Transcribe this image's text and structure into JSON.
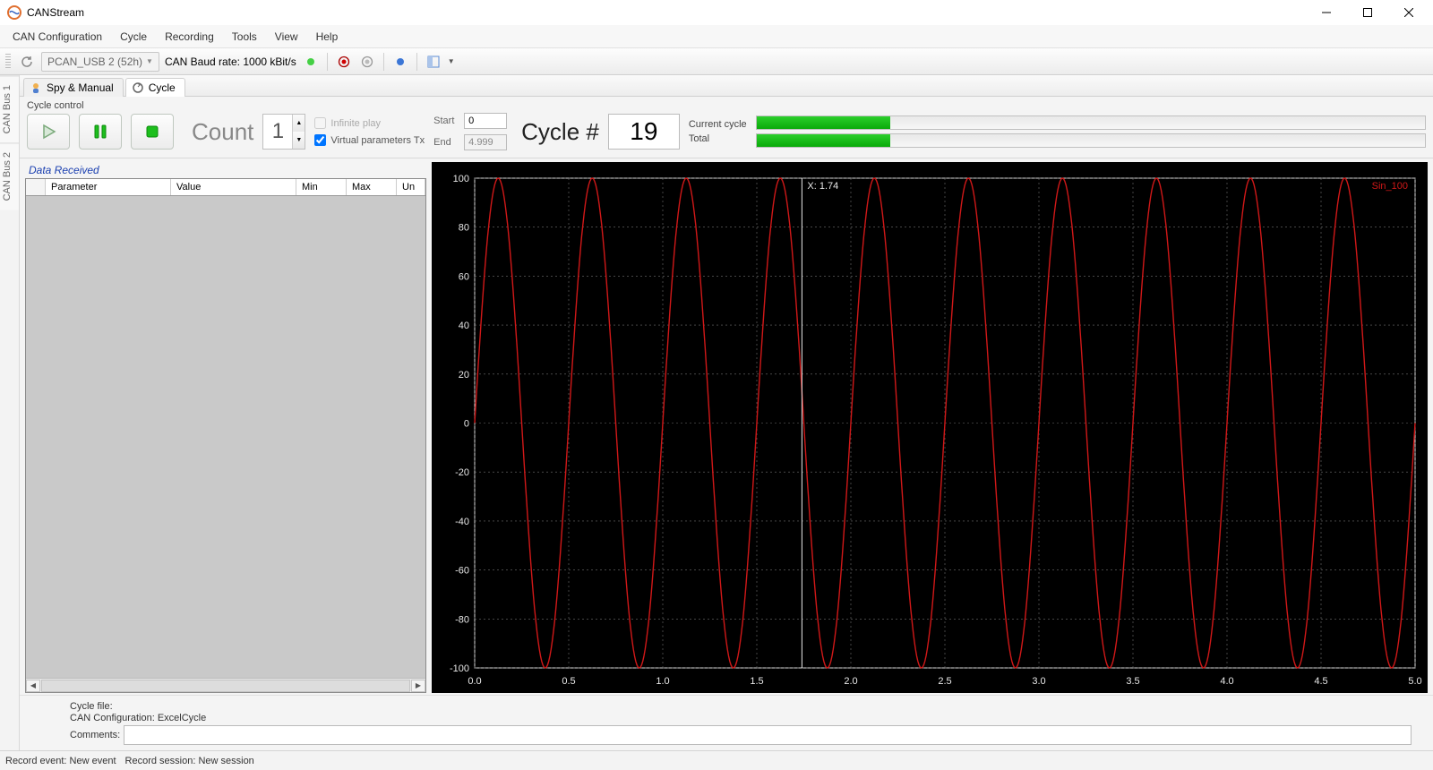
{
  "window": {
    "title": "CANStream"
  },
  "menu": {
    "can_config": "CAN Configuration",
    "cycle": "Cycle",
    "recording": "Recording",
    "tools": "Tools",
    "view": "View",
    "help": "Help"
  },
  "toolbar": {
    "device": "PCAN_USB 2 (52h)",
    "baud": "CAN Baud rate: 1000 kBit/s"
  },
  "vtabs": {
    "bus1": "CAN Bus 1",
    "bus2": "CAN Bus 2"
  },
  "doctabs": {
    "spy": "Spy & Manual",
    "cycle": "Cycle"
  },
  "cycle": {
    "group": "Cycle control",
    "count_label": "Count",
    "count_value": "1",
    "infinite": "Infinite play",
    "virtual": "Virtual parameters Tx",
    "start_label": "Start",
    "start_value": "0",
    "end_label": "End",
    "end_value": "4.999",
    "hash_label": "Cycle #",
    "hash_value": "19",
    "current_label": "Current cycle",
    "total_label": "Total",
    "progress_pct": "20%"
  },
  "grid": {
    "title": "Data Received",
    "cols": {
      "param": "Parameter",
      "value": "Value",
      "min": "Min",
      "max": "Max",
      "un": "Un"
    }
  },
  "graph": {
    "cursor_label": "X: 1.74",
    "series_label": "Sin_100",
    "y_ticks": [
      "100",
      "80",
      "60",
      "40",
      "20",
      "0",
      "-20",
      "-40",
      "-60",
      "-80",
      "-100"
    ],
    "x_ticks": [
      "0.0",
      "0.5",
      "1.0",
      "1.5",
      "2.0",
      "2.5",
      "3.0",
      "3.5",
      "4.0",
      "4.5",
      "5.0"
    ]
  },
  "info": {
    "cycle_file": "Cycle file:",
    "can_config": "CAN Configuration: ExcelCycle",
    "comments": "Comments:"
  },
  "status": {
    "record_event": "Record event: New event",
    "record_session": "Record session: New session"
  },
  "chart_data": {
    "type": "line",
    "title": "",
    "xlabel": "",
    "ylabel": "",
    "xlim": [
      0.0,
      5.0
    ],
    "ylim": [
      -100,
      100
    ],
    "cursor_x": 1.74,
    "series": [
      {
        "name": "Sin_100",
        "color": "#d01818",
        "function": "100 * sin(2*pi*2*x)",
        "frequency_hz": 2.0,
        "amplitude": 100,
        "sample_points_approx": [
          {
            "x": 0.0,
            "y": 0
          },
          {
            "x": 0.125,
            "y": 100
          },
          {
            "x": 0.25,
            "y": 0
          },
          {
            "x": 0.375,
            "y": -100
          },
          {
            "x": 0.5,
            "y": 0
          },
          {
            "x": 0.625,
            "y": 100
          },
          {
            "x": 0.75,
            "y": 0
          },
          {
            "x": 0.875,
            "y": -100
          },
          {
            "x": 1.0,
            "y": 0
          },
          {
            "x": 1.125,
            "y": 100
          },
          {
            "x": 1.25,
            "y": 0
          },
          {
            "x": 1.375,
            "y": -100
          },
          {
            "x": 1.5,
            "y": 0
          },
          {
            "x": 1.625,
            "y": 100
          },
          {
            "x": 1.75,
            "y": 0
          },
          {
            "x": 1.875,
            "y": -100
          },
          {
            "x": 2.0,
            "y": 0
          },
          {
            "x": 2.125,
            "y": 100
          },
          {
            "x": 2.25,
            "y": 0
          },
          {
            "x": 2.375,
            "y": -100
          },
          {
            "x": 2.5,
            "y": 0
          },
          {
            "x": 2.625,
            "y": 100
          },
          {
            "x": 2.75,
            "y": 0
          },
          {
            "x": 2.875,
            "y": -100
          },
          {
            "x": 3.0,
            "y": 0
          },
          {
            "x": 3.125,
            "y": 100
          },
          {
            "x": 3.25,
            "y": 0
          },
          {
            "x": 3.375,
            "y": -100
          },
          {
            "x": 3.5,
            "y": 0
          },
          {
            "x": 3.625,
            "y": 100
          },
          {
            "x": 3.75,
            "y": 0
          },
          {
            "x": 3.875,
            "y": -100
          },
          {
            "x": 4.0,
            "y": 0
          },
          {
            "x": 4.125,
            "y": 100
          },
          {
            "x": 4.25,
            "y": 0
          },
          {
            "x": 4.375,
            "y": -100
          },
          {
            "x": 4.5,
            "y": 0
          },
          {
            "x": 4.625,
            "y": 100
          },
          {
            "x": 4.75,
            "y": 0
          },
          {
            "x": 4.875,
            "y": -100
          },
          {
            "x": 5.0,
            "y": 0
          }
        ]
      }
    ]
  }
}
